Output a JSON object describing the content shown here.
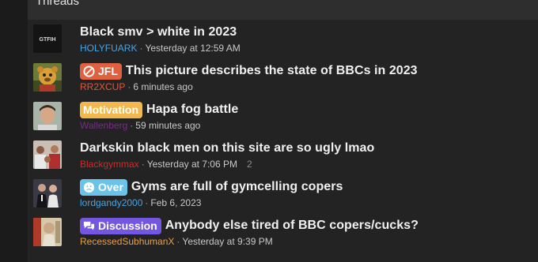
{
  "header": {
    "title": "Threads"
  },
  "threads": [
    {
      "title": "Black smv > white in 2023",
      "user": "HOLYFUARK",
      "user_color": "#4aa3df",
      "time": "Yesterday at 12:59 AM",
      "avatar": "gtfih-text-avatar",
      "avatar_text": "GTFIH"
    },
    {
      "prefix": "JFL",
      "prefix_color": "#e0613f",
      "prefix_icon": "no-symbol-icon",
      "title": "This picture describes the state of BBCs in 2023",
      "user": "RR2XCUP",
      "user_color": "#e05a3a",
      "time": "6 minutes ago",
      "avatar": "cartoon-bear-avatar"
    },
    {
      "prefix": "Motivation",
      "prefix_color": "#f2b84b",
      "title": "Hapa fog battle",
      "user": "Wallenberg",
      "user_color": "#7a2b86",
      "time": "59 minutes ago",
      "avatar": "face-photo-avatar"
    },
    {
      "title": "Darkskin black men on this site are so ugly lmao",
      "user": "Blackgymmax",
      "user_color": "#d02a2a",
      "time": "Yesterday at 7:06 PM",
      "replies": "2",
      "avatar": "group-photo-avatar"
    },
    {
      "prefix": "Over",
      "prefix_color": "#6cc3ea",
      "prefix_icon": "sad-face-icon",
      "title": "Gyms are full of gymcelling copers",
      "user": "lordgandy2000",
      "user_color": "#4aa3df",
      "time": "Feb 6, 2023",
      "avatar": "suit-photo-avatar"
    },
    {
      "prefix": "Discussion",
      "prefix_color": "#7357e0",
      "prefix_icon": "speech-bubbles-icon",
      "title": "Anybody else tired of BBC copers/cucks?",
      "user": "RecessedSubhumanX",
      "user_color": "#e8a04a",
      "time": "Yesterday at 9:39 PM",
      "avatar": "statue-photo-avatar"
    }
  ]
}
